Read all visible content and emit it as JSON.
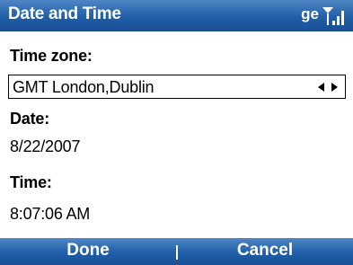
{
  "titlebar": {
    "title": "Date and Time",
    "status_text": "ge",
    "signal_icon": "signal-strength-icon",
    "color": "#1f5ea8"
  },
  "form": {
    "timezone_label": "Time zone:",
    "timezone_value": "GMT London,Dublin",
    "date_label": "Date:",
    "date_value": "8/22/2007",
    "time_label": "Time:",
    "time_value": "8:07:06 AM"
  },
  "softkeys": {
    "left": "Done",
    "right": "Cancel"
  }
}
